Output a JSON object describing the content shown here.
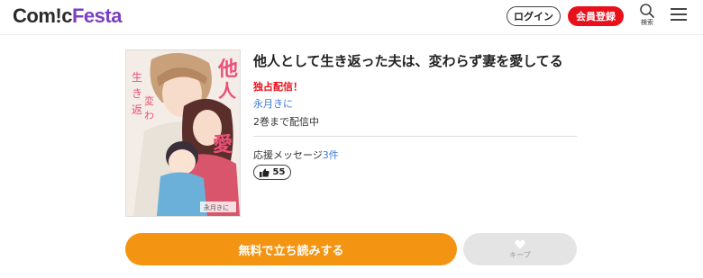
{
  "header": {
    "logo_part1": "Com!c",
    "logo_part2": "Festa",
    "login_label": "ログイン",
    "register_label": "会員登録",
    "search_label": "検索"
  },
  "book": {
    "title": "他人として生き返った夫は、変わらず妻を愛してる",
    "exclusive_label": "独占配信！",
    "author": "永月きに",
    "status": "2巻まで配信中",
    "support_prefix": "応援メッセージ",
    "support_count": "3件",
    "like_count": "55"
  },
  "cover": {
    "title_text": "他人として",
    "subtitle_text": "生き返った夫は変わらず妻を愛してる",
    "author_text": "永月きに"
  },
  "actions": {
    "read_label": "無料で立ち読みする",
    "keep_label": "キープ"
  },
  "colors": {
    "brand_purple": "#7b3fbf",
    "register_red": "#e8101a",
    "read_orange": "#f39412",
    "link_blue": "#3a7bd5"
  }
}
